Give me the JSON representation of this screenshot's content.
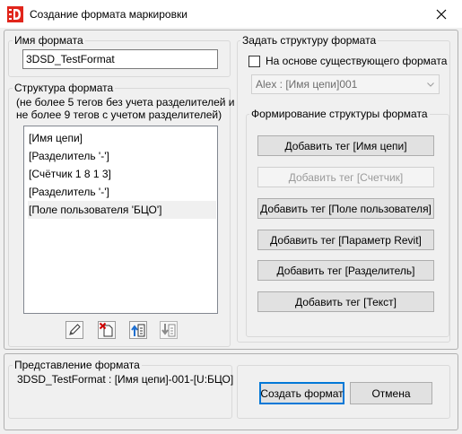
{
  "window": {
    "title": "Создание формата маркировки"
  },
  "format_name": {
    "legend": "Имя формата",
    "value": "3DSD_TestFormat"
  },
  "structure": {
    "legend": "Структура формата",
    "hint_line1": "(не более 5 тегов без учета разделителей и",
    "hint_line2": "не более 9 тегов с учетом разделителей)",
    "items": [
      {
        "label": "[Имя цепи]"
      },
      {
        "label": "[Разделитель '-']"
      },
      {
        "label": "[Счётчик 1 8 1 3]"
      },
      {
        "label": "[Разделитель '-']"
      },
      {
        "label": "[Поле пользователя 'БЦО']"
      }
    ],
    "selected_index": 4,
    "toolbar": {
      "edit_icon": "pencil-edit-icon",
      "delete_icon": "delete-item-icon",
      "move_up_icon": "move-up-icon",
      "move_down_icon": "move-down-icon"
    }
  },
  "set_structure": {
    "legend": "Задать структуру формата",
    "checkbox_label": "На основе существующего формата",
    "checkbox_checked": false,
    "combo_value": "Alex : [Имя цепи]001"
  },
  "build_structure": {
    "legend": "Формирование структуры формата",
    "buttons": [
      {
        "label": "Добавить тег [Имя цепи]",
        "enabled": true
      },
      {
        "label": "Добавить тег [Счетчик]",
        "enabled": false
      },
      {
        "label": "Добавить тег [Поле пользователя]",
        "enabled": true
      },
      {
        "label": "Добавить тег [Параметр Revit]",
        "enabled": true
      },
      {
        "label": "Добавить тег [Разделитель]",
        "enabled": true
      },
      {
        "label": "Добавить тег [Текст]",
        "enabled": true
      }
    ]
  },
  "preview": {
    "legend": "Представление формата",
    "value": "3DSD_TestFormat : [Имя цепи]-001-[U:БЦО]"
  },
  "actions": {
    "create_label": "Создать формат",
    "cancel_label": "Отмена"
  },
  "colors": {
    "accent": "#0078d7",
    "logo_red": "#e1251b",
    "disabled_text": "#9a9a9a"
  }
}
